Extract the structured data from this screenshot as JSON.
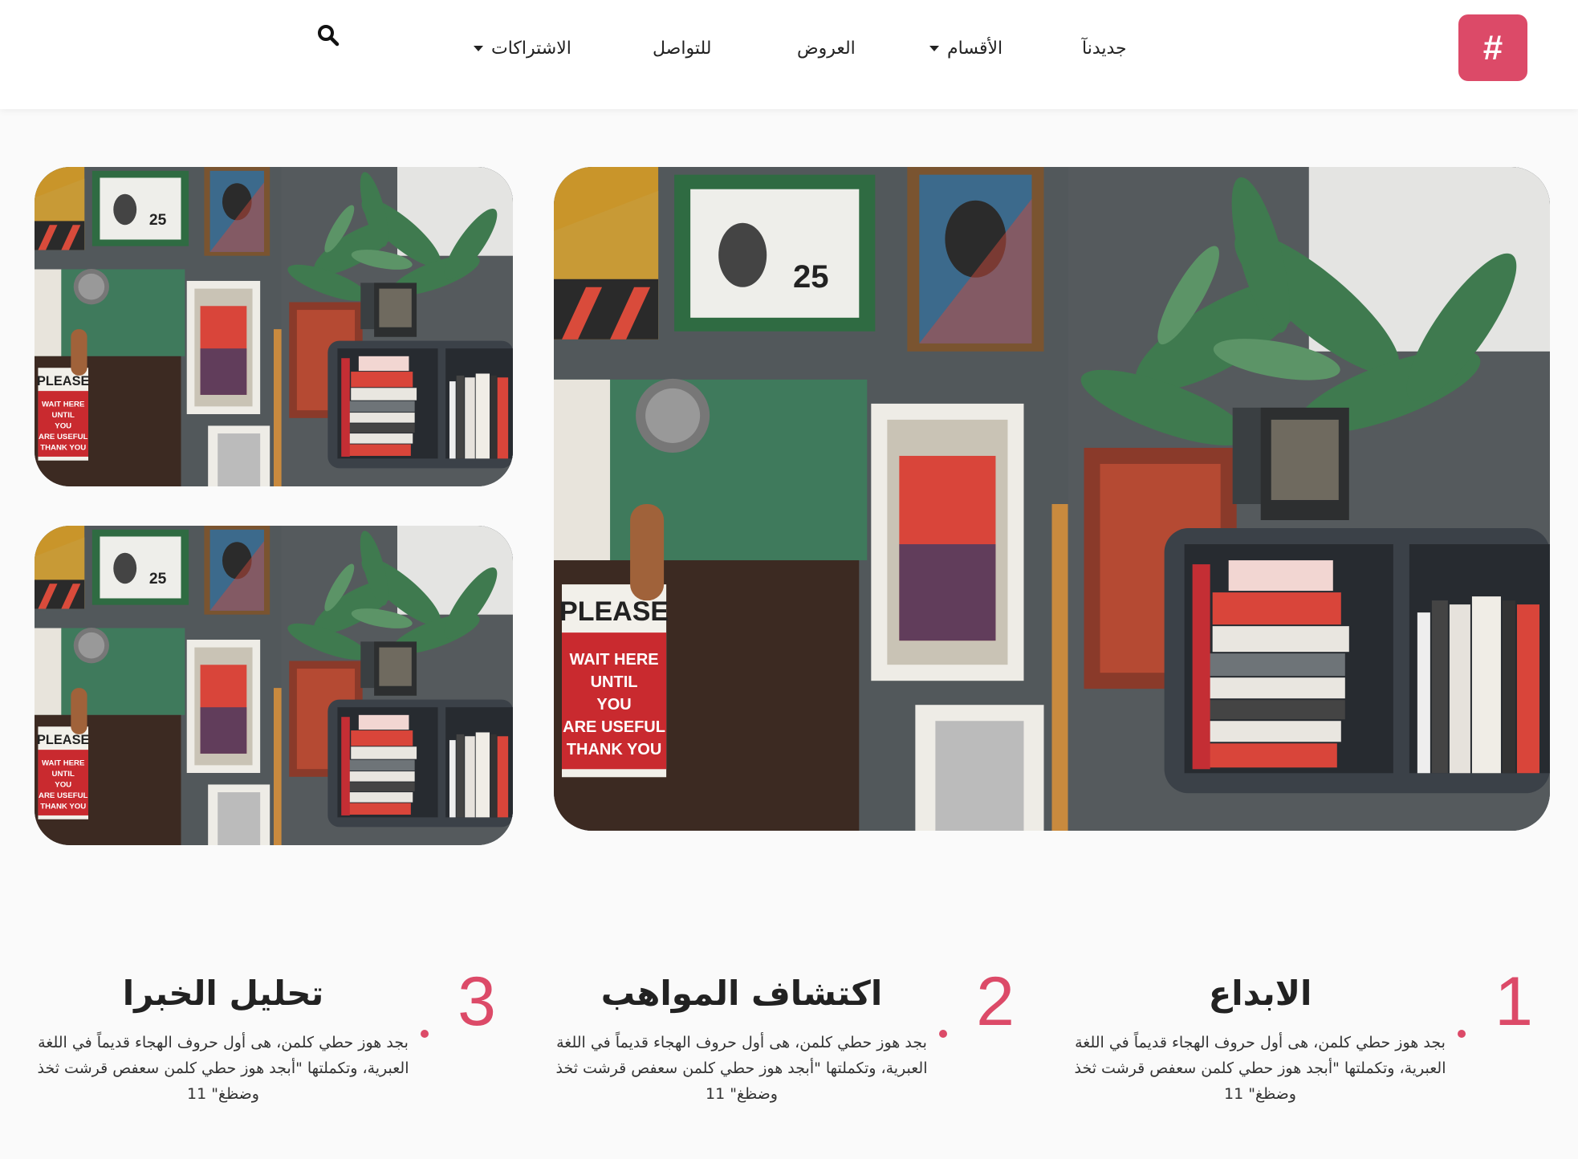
{
  "header": {
    "logo_text": "#",
    "nav": [
      {
        "label": "جديدنآ",
        "has_dropdown": false
      },
      {
        "label": "الأقسام",
        "has_dropdown": true
      },
      {
        "label": "العروض",
        "has_dropdown": false
      },
      {
        "label": "للتواصل",
        "has_dropdown": false
      },
      {
        "label": "الاشتراكات",
        "has_dropdown": true
      }
    ],
    "search_icon": "search-icon",
    "accent_color": "#dc4a68"
  },
  "gallery": {
    "image_description_icon": "photo-shelf-plant-wall-art"
  },
  "features": [
    {
      "number": "1",
      "title": "الابداع",
      "text": "بجد هوز حطي كلمن، هى أول حروف الهجاء قديماً في اللغة العبرية، وتكملتها \"أبجد هوز حطي كلمن سعفص قرشت ثخذ وضظغ\" 11"
    },
    {
      "number": "2",
      "title": "اكتشاف المواهب",
      "text": "بجد هوز حطي كلمن، هى أول حروف الهجاء قديماً في اللغة العبرية، وتكملتها \"أبجد هوز حطي كلمن سعفص قرشت ثخذ وضظغ\" 11"
    },
    {
      "number": "3",
      "title": "تحليل الخبرا",
      "text": "بجد هوز حطي كلمن، هى أول حروف الهجاء قديماً في اللغة العبرية، وتكملتها \"أبجد هوز حطي كلمن سعفص قرشت ثخذ وضظغ\" 11"
    }
  ]
}
